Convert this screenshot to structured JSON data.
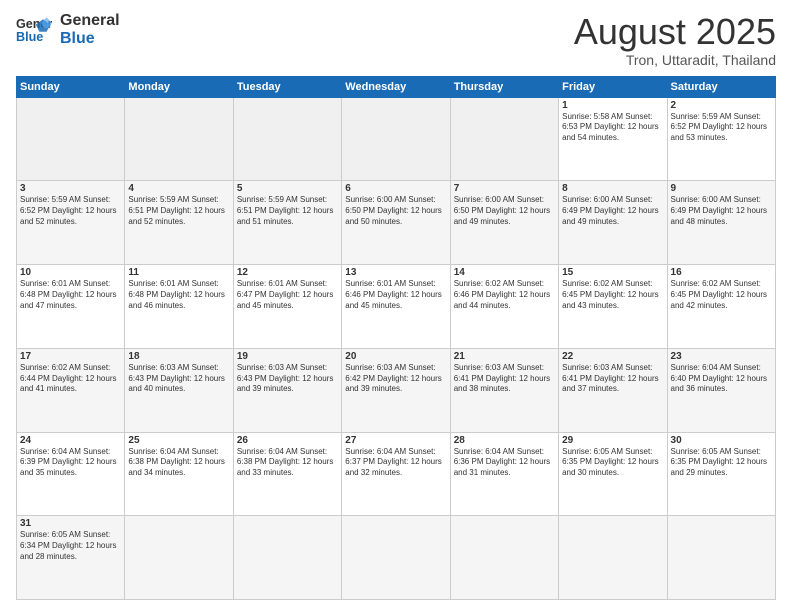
{
  "header": {
    "logo_general": "General",
    "logo_blue": "Blue",
    "month_title": "August 2025",
    "location": "Tron, Uttaradit, Thailand"
  },
  "weekdays": [
    "Sunday",
    "Monday",
    "Tuesday",
    "Wednesday",
    "Thursday",
    "Friday",
    "Saturday"
  ],
  "weeks": [
    [
      {
        "day": "",
        "info": ""
      },
      {
        "day": "",
        "info": ""
      },
      {
        "day": "",
        "info": ""
      },
      {
        "day": "",
        "info": ""
      },
      {
        "day": "",
        "info": ""
      },
      {
        "day": "1",
        "info": "Sunrise: 5:58 AM\nSunset: 6:53 PM\nDaylight: 12 hours\nand 54 minutes."
      },
      {
        "day": "2",
        "info": "Sunrise: 5:59 AM\nSunset: 6:52 PM\nDaylight: 12 hours\nand 53 minutes."
      }
    ],
    [
      {
        "day": "3",
        "info": "Sunrise: 5:59 AM\nSunset: 6:52 PM\nDaylight: 12 hours\nand 52 minutes."
      },
      {
        "day": "4",
        "info": "Sunrise: 5:59 AM\nSunset: 6:51 PM\nDaylight: 12 hours\nand 52 minutes."
      },
      {
        "day": "5",
        "info": "Sunrise: 5:59 AM\nSunset: 6:51 PM\nDaylight: 12 hours\nand 51 minutes."
      },
      {
        "day": "6",
        "info": "Sunrise: 6:00 AM\nSunset: 6:50 PM\nDaylight: 12 hours\nand 50 minutes."
      },
      {
        "day": "7",
        "info": "Sunrise: 6:00 AM\nSunset: 6:50 PM\nDaylight: 12 hours\nand 49 minutes."
      },
      {
        "day": "8",
        "info": "Sunrise: 6:00 AM\nSunset: 6:49 PM\nDaylight: 12 hours\nand 49 minutes."
      },
      {
        "day": "9",
        "info": "Sunrise: 6:00 AM\nSunset: 6:49 PM\nDaylight: 12 hours\nand 48 minutes."
      }
    ],
    [
      {
        "day": "10",
        "info": "Sunrise: 6:01 AM\nSunset: 6:48 PM\nDaylight: 12 hours\nand 47 minutes."
      },
      {
        "day": "11",
        "info": "Sunrise: 6:01 AM\nSunset: 6:48 PM\nDaylight: 12 hours\nand 46 minutes."
      },
      {
        "day": "12",
        "info": "Sunrise: 6:01 AM\nSunset: 6:47 PM\nDaylight: 12 hours\nand 45 minutes."
      },
      {
        "day": "13",
        "info": "Sunrise: 6:01 AM\nSunset: 6:46 PM\nDaylight: 12 hours\nand 45 minutes."
      },
      {
        "day": "14",
        "info": "Sunrise: 6:02 AM\nSunset: 6:46 PM\nDaylight: 12 hours\nand 44 minutes."
      },
      {
        "day": "15",
        "info": "Sunrise: 6:02 AM\nSunset: 6:45 PM\nDaylight: 12 hours\nand 43 minutes."
      },
      {
        "day": "16",
        "info": "Sunrise: 6:02 AM\nSunset: 6:45 PM\nDaylight: 12 hours\nand 42 minutes."
      }
    ],
    [
      {
        "day": "17",
        "info": "Sunrise: 6:02 AM\nSunset: 6:44 PM\nDaylight: 12 hours\nand 41 minutes."
      },
      {
        "day": "18",
        "info": "Sunrise: 6:03 AM\nSunset: 6:43 PM\nDaylight: 12 hours\nand 40 minutes."
      },
      {
        "day": "19",
        "info": "Sunrise: 6:03 AM\nSunset: 6:43 PM\nDaylight: 12 hours\nand 39 minutes."
      },
      {
        "day": "20",
        "info": "Sunrise: 6:03 AM\nSunset: 6:42 PM\nDaylight: 12 hours\nand 39 minutes."
      },
      {
        "day": "21",
        "info": "Sunrise: 6:03 AM\nSunset: 6:41 PM\nDaylight: 12 hours\nand 38 minutes."
      },
      {
        "day": "22",
        "info": "Sunrise: 6:03 AM\nSunset: 6:41 PM\nDaylight: 12 hours\nand 37 minutes."
      },
      {
        "day": "23",
        "info": "Sunrise: 6:04 AM\nSunset: 6:40 PM\nDaylight: 12 hours\nand 36 minutes."
      }
    ],
    [
      {
        "day": "24",
        "info": "Sunrise: 6:04 AM\nSunset: 6:39 PM\nDaylight: 12 hours\nand 35 minutes."
      },
      {
        "day": "25",
        "info": "Sunrise: 6:04 AM\nSunset: 6:38 PM\nDaylight: 12 hours\nand 34 minutes."
      },
      {
        "day": "26",
        "info": "Sunrise: 6:04 AM\nSunset: 6:38 PM\nDaylight: 12 hours\nand 33 minutes."
      },
      {
        "day": "27",
        "info": "Sunrise: 6:04 AM\nSunset: 6:37 PM\nDaylight: 12 hours\nand 32 minutes."
      },
      {
        "day": "28",
        "info": "Sunrise: 6:04 AM\nSunset: 6:36 PM\nDaylight: 12 hours\nand 31 minutes."
      },
      {
        "day": "29",
        "info": "Sunrise: 6:05 AM\nSunset: 6:35 PM\nDaylight: 12 hours\nand 30 minutes."
      },
      {
        "day": "30",
        "info": "Sunrise: 6:05 AM\nSunset: 6:35 PM\nDaylight: 12 hours\nand 29 minutes."
      }
    ],
    [
      {
        "day": "31",
        "info": "Sunrise: 6:05 AM\nSunset: 6:34 PM\nDaylight: 12 hours\nand 28 minutes."
      },
      {
        "day": "",
        "info": ""
      },
      {
        "day": "",
        "info": ""
      },
      {
        "day": "",
        "info": ""
      },
      {
        "day": "",
        "info": ""
      },
      {
        "day": "",
        "info": ""
      },
      {
        "day": "",
        "info": ""
      }
    ]
  ]
}
